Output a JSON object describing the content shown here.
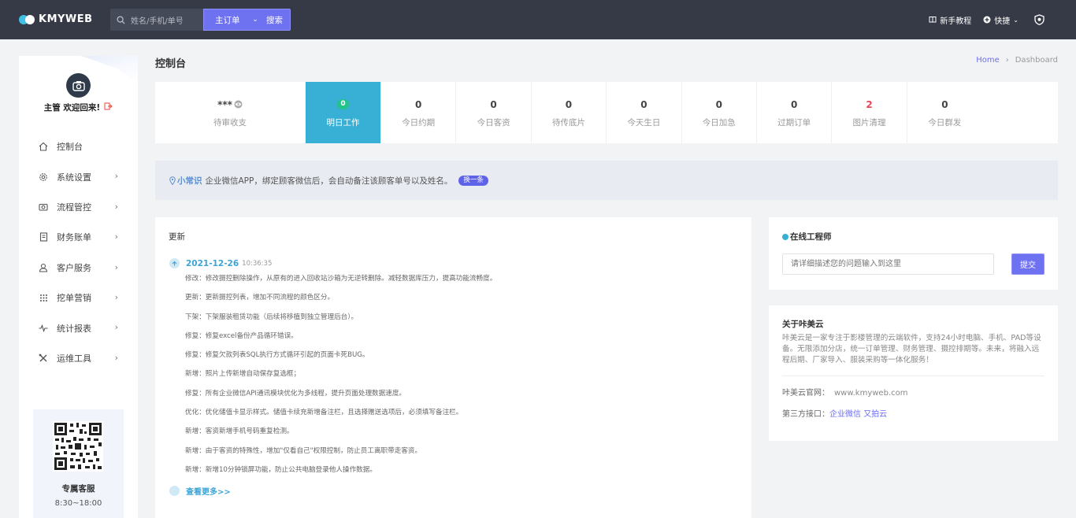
{
  "topbar": {
    "brand": "KMYWEB",
    "search_placeholder": "姓名/手机/单号",
    "search_type": "主订单",
    "search_button": "搜索",
    "tutorial": "新手教程",
    "quick": "快捷"
  },
  "sidebar": {
    "welcome": "主管 欢迎回来!",
    "items": [
      {
        "label": "控制台",
        "icon": "home-icon",
        "arrow": false
      },
      {
        "label": "系统设置",
        "icon": "gear-icon",
        "arrow": true
      },
      {
        "label": "流程管控",
        "icon": "camera-icon",
        "arrow": true
      },
      {
        "label": "财务账单",
        "icon": "bill-icon",
        "arrow": true
      },
      {
        "label": "客户服务",
        "icon": "user-icon",
        "arrow": true
      },
      {
        "label": "挖单营销",
        "icon": "grid-icon",
        "arrow": true
      },
      {
        "label": "统计报表",
        "icon": "pulse-icon",
        "arrow": true
      },
      {
        "label": "运维工具",
        "icon": "tools-icon",
        "arrow": true
      }
    ],
    "service_title": "专属客服",
    "service_hours": "8:30~18:00"
  },
  "page": {
    "title": "控制台",
    "crumb_home": "Home",
    "crumb_sep": "›",
    "crumb_current": "Dashboard"
  },
  "stats": [
    {
      "value": "***",
      "label": "待审收支"
    },
    {
      "value": "0",
      "label": "明日工作"
    },
    {
      "value": "0",
      "label": "今日约期"
    },
    {
      "value": "0",
      "label": "今日客资"
    },
    {
      "value": "0",
      "label": "待传底片"
    },
    {
      "value": "0",
      "label": "今天生日"
    },
    {
      "value": "0",
      "label": "今日加急"
    },
    {
      "value": "0",
      "label": "过期订单"
    },
    {
      "value": "2",
      "label": "图片清理"
    },
    {
      "value": "0",
      "label": "今日群发"
    }
  ],
  "tip": {
    "key": "小常识",
    "text": "企业微信APP，绑定顾客微信后，会自动备注该顾客单号以及姓名。",
    "button": "换一条"
  },
  "updates": {
    "title": "更新",
    "date": "2021-12-26",
    "time": "10:36:35",
    "items": [
      "修改：修改摄控删除操作，从原有的进入回收站沙箱为无逆转删除。减轻数据库压力，提高功能流畅度。",
      "更新：更新摄控列表，增加不同流程的颜色区分。",
      "下架：下架服装租赁功能（后续将移植到独立管理后台）。",
      "修复：修复excel备份产品循环错误。",
      "修复：修复欠款列表SQL执行方式循环引起的页面卡死BUG。",
      "新增：照片上传新增自动保存复选框；",
      "修复：所有企业微信API通讯模块优化为多线程，提升页面处理数据速度。",
      "优化：优化储值卡显示样式。储值卡续充新增备注栏，且选择赠送选项后，必须填写备注栏。",
      "新增：客资新增手机号码重复检测。",
      "新增：由于客资的特殊性，增加\"仅看自己\"权限控制，防止员工离职带走客资。",
      "新增：新增10分钟锁屏功能，防止公共电脑登录他人操作数据。"
    ],
    "more": "查看更多>>"
  },
  "engineer": {
    "title": "在线工程师",
    "placeholder": "请详细描述您的问题输入到这里",
    "submit": "提交"
  },
  "about": {
    "title": "关于咔美云",
    "desc": "咔美云是一家专注于影楼管理的云端软件，支持24小时电脑、手机、PAD等设备。无限添加分店，统一订单管理、财务管理、摄控排期等。未来，将融入远程后期、厂家导入、服装采购等一体化服务！",
    "site_label": "咔美云官网：",
    "site_value": "www.kmyweb.com",
    "api_label": "第三方接口：",
    "api_link1": "企业微信",
    "api_link2": "又拍云"
  },
  "colors": {
    "topbar": "#363a47",
    "accent": "#6f72f0",
    "active_stat": "#38b0d6",
    "alert": "#ec4658"
  }
}
